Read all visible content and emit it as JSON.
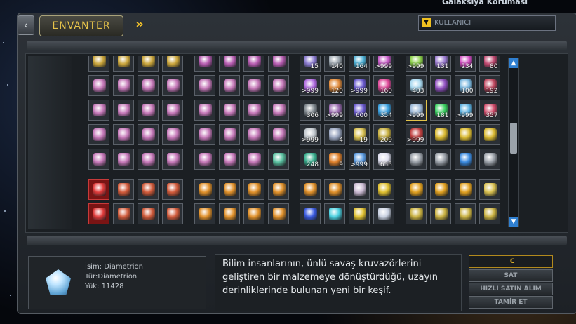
{
  "header": {
    "top_right_text": "Galaksiya Koruması",
    "tab_label": "ENVANTER",
    "next_icon": "double-chevron-right-icon",
    "back_icon": "chevron-left-icon",
    "dropdown_value": "KULLANICI"
  },
  "inventory": {
    "columns": [
      0,
      1,
      2,
      3,
      4.3,
      5.3,
      6.3,
      7.3,
      8.6,
      9.6,
      10.6,
      11.6,
      12.9,
      13.9,
      14.9,
      15.9
    ],
    "rows": [
      {
        "type": "top",
        "cells": [
          {
            "c": "#c9a43a"
          },
          {
            "c": "#c9a43a"
          },
          {
            "c": "#c9a43a"
          },
          {
            "c": "#c9a43a"
          },
          {
            "c": "#b65bb0"
          },
          {
            "c": "#b65bb0"
          },
          {
            "c": "#b65bb0"
          },
          {
            "c": "#b65bb0"
          },
          {
            "c": "#8a7ad0",
            "n": "15"
          },
          {
            "c": "#9aa4ad",
            "n": "140"
          },
          {
            "c": "#4bb0d6",
            "n": "164"
          },
          {
            "c": "#c85bc8",
            "n": ">999"
          },
          {
            "c": "#8bd04a",
            "n": ">999"
          },
          {
            "c": "#9a7ad0",
            "n": "131"
          },
          {
            "c": "#d04ac0",
            "n": "234"
          },
          {
            "c": "#c04870",
            "n": "80"
          }
        ]
      },
      {
        "cells": [
          {
            "c": "#c679b9"
          },
          {
            "c": "#c679b9"
          },
          {
            "c": "#c679b9"
          },
          {
            "c": "#c679b9"
          },
          {
            "c": "#c679b9"
          },
          {
            "c": "#c679b9"
          },
          {
            "c": "#c679b9"
          },
          {
            "c": "#c679b9"
          },
          {
            "c": "#b06ae0",
            "n": ">999"
          },
          {
            "c": "#e08a3a",
            "n": "120"
          },
          {
            "c": "#6a5ad0",
            "n": ">999"
          },
          {
            "c": "#e04a9a",
            "n": "160"
          },
          {
            "c": "#a8d8ef",
            "n": "403"
          },
          {
            "c": "#9050c0",
            "n": ""
          },
          {
            "c": "#7ab8e0",
            "n": "100"
          },
          {
            "c": "#c04860",
            "n": "192"
          }
        ]
      },
      {
        "cells": [
          {
            "c": "#c679b9"
          },
          {
            "c": "#c679b9"
          },
          {
            "c": "#c679b9"
          },
          {
            "c": "#c679b9"
          },
          {
            "c": "#c679b9"
          },
          {
            "c": "#c679b9"
          },
          {
            "c": "#c679b9"
          },
          {
            "c": "#c679b9"
          },
          {
            "c": "#7d858c",
            "n": "306"
          },
          {
            "c": "#9a6ab0",
            "n": ">999"
          },
          {
            "c": "#6a5ad0",
            "n": "600"
          },
          {
            "c": "#3aa0e0",
            "n": "354"
          },
          {
            "c": "#9bb8d8",
            "n": ">999",
            "sel": true
          },
          {
            "c": "#3ad060",
            "n": "181"
          },
          {
            "c": "#5ab0e0",
            "n": ">999"
          },
          {
            "c": "#d04a6a",
            "n": "357"
          }
        ]
      },
      {
        "cells": [
          {
            "c": "#c679b9"
          },
          {
            "c": "#c679b9"
          },
          {
            "c": "#c679b9"
          },
          {
            "c": "#c679b9"
          },
          {
            "c": "#c679b9"
          },
          {
            "c": "#c679b9"
          },
          {
            "c": "#c679b9"
          },
          {
            "c": "#c679b9"
          },
          {
            "c": "#c2c8ce",
            "n": ">999"
          },
          {
            "c": "#9aa6c0",
            "n": "4"
          },
          {
            "c": "#d8c050",
            "n": "19"
          },
          {
            "c": "#c8b040",
            "n": "209"
          },
          {
            "c": "#c04040",
            "n": ">999"
          },
          {
            "c": "#d8b830"
          },
          {
            "c": "#d8b830"
          },
          {
            "c": "#d8b830"
          }
        ]
      },
      {
        "cells": [
          {
            "c": "#c679b9"
          },
          {
            "c": "#c679b9"
          },
          {
            "c": "#c679b9"
          },
          {
            "c": "#c679b9"
          },
          {
            "c": "#c679b9"
          },
          {
            "c": "#c679b9"
          },
          {
            "c": "#c679b9"
          },
          {
            "c": "#5ac0a0"
          },
          {
            "c": "#3ab090",
            "n": "248"
          },
          {
            "c": "#e0802a",
            "n": "9"
          },
          {
            "c": "#5a9ae0",
            "n": ">999"
          },
          {
            "c": "#e0e0f0",
            "n": "655"
          },
          {
            "c": "#9aa0a8"
          },
          {
            "c": "#9aa0a8"
          },
          {
            "c": "#3a8ae0"
          },
          {
            "c": "#9aa0a8"
          }
        ]
      },
      {
        "type": "gap"
      },
      {
        "cells": [
          {
            "c": "#e03a3a",
            "red": true
          },
          {
            "c": "#d05a3a"
          },
          {
            "c": "#d05a3a"
          },
          {
            "c": "#d05a3a"
          },
          {
            "c": "#e0902a"
          },
          {
            "c": "#e0902a"
          },
          {
            "c": "#e0902a"
          },
          {
            "c": "#e0902a"
          },
          {
            "c": "#e0902a"
          },
          {
            "c": "#e0902a"
          },
          {
            "c": "#c8b8d0"
          },
          {
            "c": "#e0c030"
          },
          {
            "c": "#e0a020"
          },
          {
            "c": "#e0a020"
          },
          {
            "c": "#e0a020"
          },
          {
            "c": "#d8c050"
          }
        ]
      },
      {
        "cells": [
          {
            "c": "#e03a3a",
            "red": true
          },
          {
            "c": "#d05a3a"
          },
          {
            "c": "#d05a3a"
          },
          {
            "c": "#d05a3a"
          },
          {
            "c": "#e0902a"
          },
          {
            "c": "#e0902a"
          },
          {
            "c": "#e0902a"
          },
          {
            "c": "#e0902a"
          },
          {
            "c": "#3a5ae0"
          },
          {
            "c": "#4ad0e0"
          },
          {
            "c": "#e0c030"
          },
          {
            "c": "#c8d0e0"
          },
          {
            "c": "#c8b040"
          },
          {
            "c": "#c8b040"
          },
          {
            "c": "#c8b040"
          },
          {
            "c": "#c8b040"
          }
        ]
      }
    ]
  },
  "scroll": {
    "up_icon": "scroll-up-icon",
    "down_icon": "scroll-down-icon"
  },
  "item_info": {
    "name": "İsim: Diametrion",
    "type": "Tür:Diametrion",
    "load": "Yük: 11428",
    "icon": "diametrion-gem-icon"
  },
  "description": "Bilim insanlarının, ünlü savaş kruvazörlerini geliştiren bir malzemeye dönüştürdüğü, uzayın derinliklerinde bulunan yeni bir keşif.",
  "actions": {
    "currency": "_C",
    "sell": "SAT",
    "quick_buy": "HIZLI SATIN ALIM",
    "repair": "TAMİR ET"
  }
}
